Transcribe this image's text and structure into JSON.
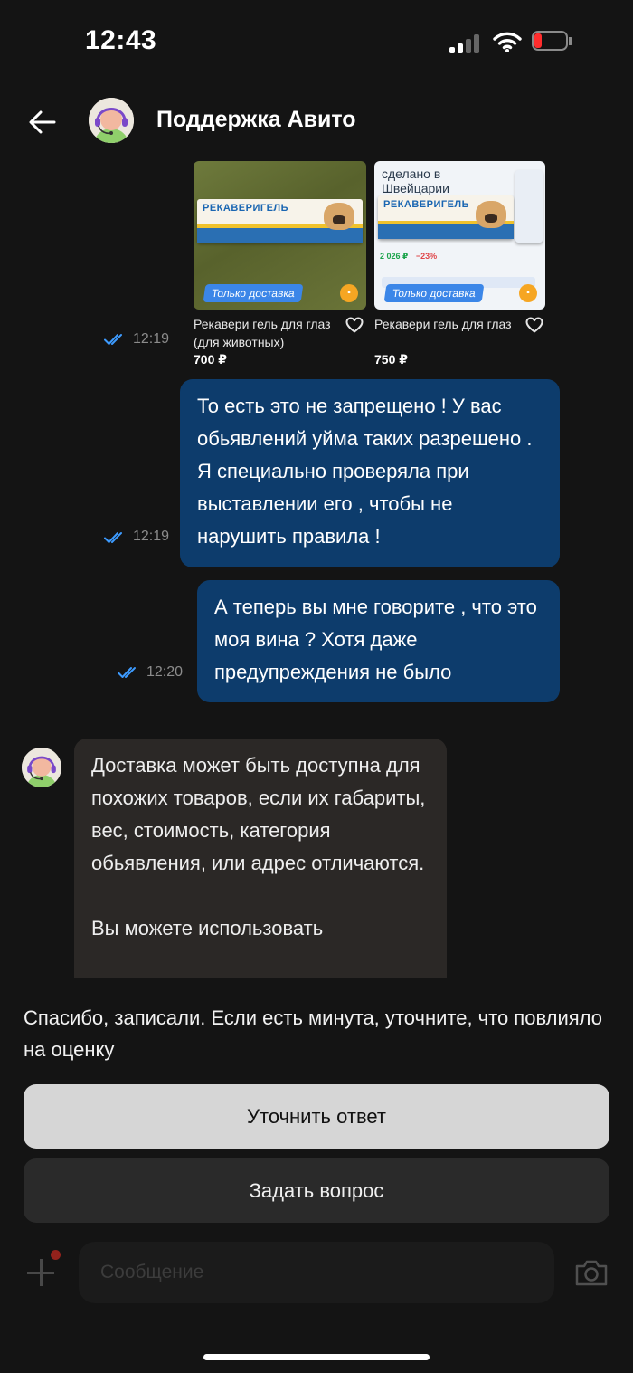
{
  "status_bar": {
    "time": "12:43"
  },
  "header": {
    "title": "Поддержка Авито",
    "back_icon": "arrow-left-icon",
    "avatar_icon": "support-agent-avatar"
  },
  "products": [
    {
      "title": "Рекавери гель для глаз (для животных)",
      "price": "700 ₽",
      "delivery_tag": "Только доставка",
      "image_text": "РЕКАВЕРИГЕЛЬ"
    },
    {
      "title": "Рекавери гель для глаз",
      "price": "750 ₽",
      "delivery_tag": "Только доставка",
      "image_text": "РЕКАВЕРИГЕЛЬ",
      "image_headline": "сделано в Швейцарии",
      "image_price": "2 026 ₽",
      "image_discount": "−23%"
    }
  ],
  "messages": [
    {
      "type": "products",
      "time": "12:19"
    },
    {
      "type": "outgoing",
      "time": "12:19",
      "text": "То есть это не запрещено ! У вас обьявлений уйма таких разрешено . Я специально проверяла при выставлении его , чтобы не нарушить правила !"
    },
    {
      "type": "outgoing",
      "time": "12:20",
      "text": "А теперь вы мне говорите , что это моя вина ? Хотя даже предупреждения не было"
    },
    {
      "type": "incoming",
      "paragraphs": [
        "Доставка может быть доступна для похожих товаров, если их габариты, вес, стоимость, категория обьявления, или адрес отличаются.",
        "Вы можете использовать"
      ]
    }
  ],
  "feedback_sheet": {
    "text": "Спасибо, записали. Если есть минута, уточните, что повлияло на оценку",
    "primary_button": "Уточнить ответ",
    "secondary_button": "Задать вопрос"
  },
  "composer": {
    "placeholder": "Сообщение"
  },
  "colors": {
    "background": "#141414",
    "outgoing_bubble": "#0d3c6c",
    "incoming_bubble": "#2b2826",
    "read_tick": "#3d9bff",
    "primary_button": "#d6d6d6",
    "secondary_button": "#2a2a2a"
  }
}
